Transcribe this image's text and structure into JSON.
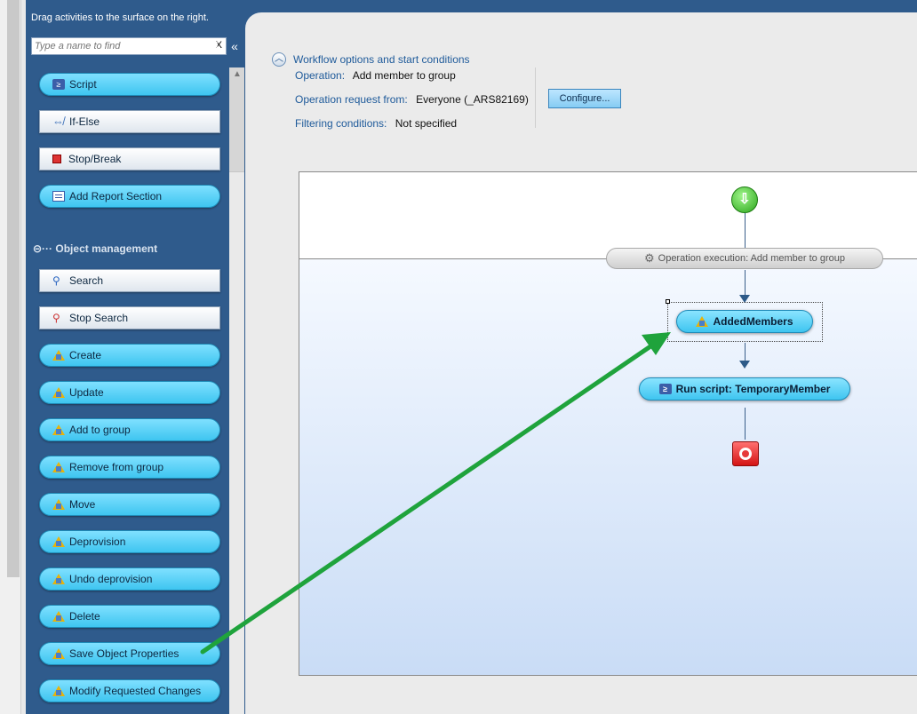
{
  "toolbox": {
    "hint": "Drag activities to the surface on the right.",
    "search_placeholder": "Type a name to find",
    "clear_label": "X",
    "refresh_icon": "refresh-icon",
    "collapse_icon": "double-chevron-left-icon",
    "top_activities": [
      "Script",
      "If-Else",
      "Stop/Break",
      "Add Report Section"
    ],
    "section_title": "Object management",
    "section_toggle": "⊝···",
    "object_activities": [
      "Search",
      "Stop Search",
      "Create",
      "Update",
      "Add to group",
      "Remove from group",
      "Move",
      "Deprovision",
      "Undo deprovision",
      "Delete",
      "Save Object Properties",
      "Modify Requested Changes"
    ]
  },
  "options": {
    "header": "Workflow options and start conditions",
    "operation_label": "Operation:",
    "operation_value": "Add member to group",
    "request_label": "Operation request from:",
    "request_value": "Everyone (_ARS82169)",
    "filter_label": "Filtering conditions:",
    "filter_value": "Not specified",
    "configure_label": "Configure..."
  },
  "workflow": {
    "execution_label": "Operation execution: Add member to group",
    "node1_label": "AddedMembers",
    "node2_label": "Run script: TemporaryMember"
  },
  "colors": {
    "toolbox_bg": "#2f5b8c",
    "pill": "#3ec5f0",
    "annotation_arrow": "#1fa33c"
  }
}
